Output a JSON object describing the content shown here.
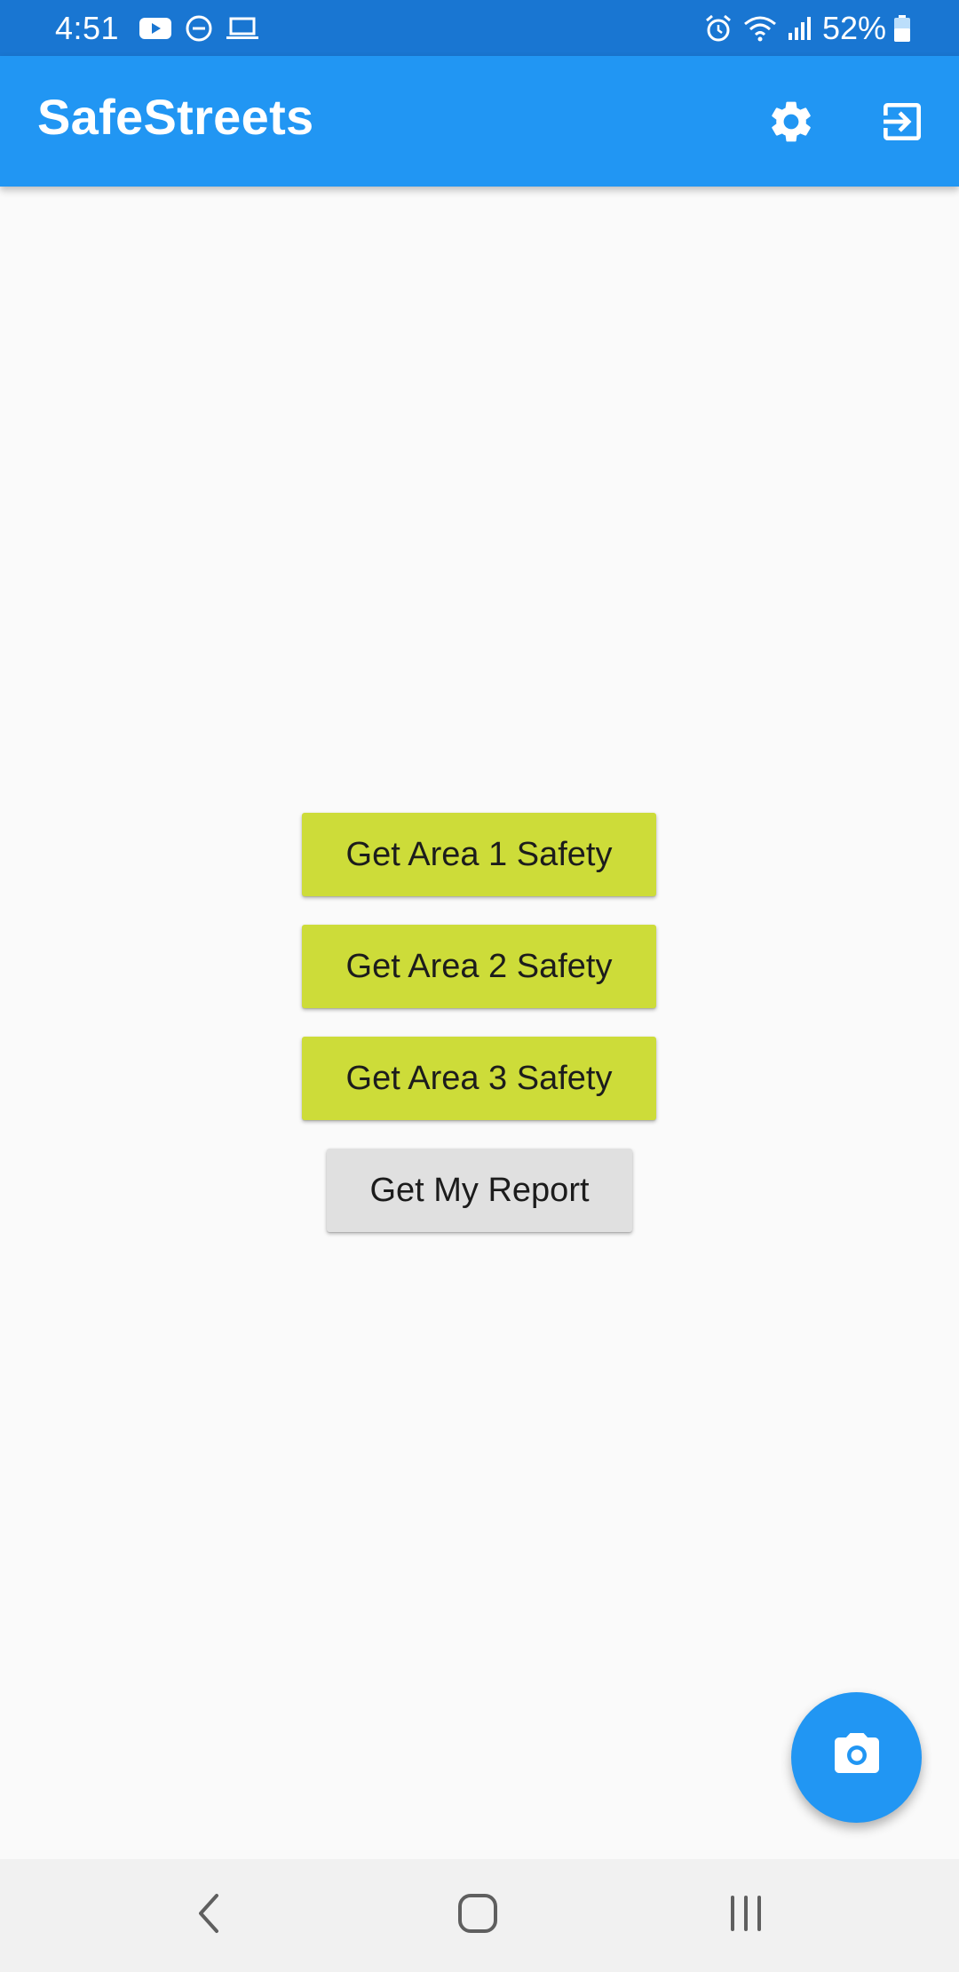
{
  "status_bar": {
    "time": "4:51",
    "battery": "52%",
    "left_icons": [
      "youtube-icon",
      "do-not-disturb-icon",
      "laptop-icon"
    ],
    "right_icons": [
      "alarm-icon",
      "wifi-icon",
      "signal-icon",
      "battery-icon"
    ],
    "background": "#1976d2"
  },
  "app_bar": {
    "title": "SafeStreets",
    "actions": [
      "settings-icon",
      "logout-icon"
    ],
    "background": "#2196f3"
  },
  "main": {
    "buttons": [
      {
        "label": "Get Area 1 Safety",
        "color": "#cddc39"
      },
      {
        "label": "Get Area 2 Safety",
        "color": "#cddc39"
      },
      {
        "label": "Get Area 3 Safety",
        "color": "#cddc39"
      },
      {
        "label": "Get My Report",
        "color": "#e0e0e0"
      }
    ]
  },
  "fab": {
    "icon": "camera-icon",
    "color": "#2196f3"
  },
  "nav_bar": {
    "items": [
      "back-icon",
      "home-icon",
      "recent-apps-icon"
    ]
  }
}
